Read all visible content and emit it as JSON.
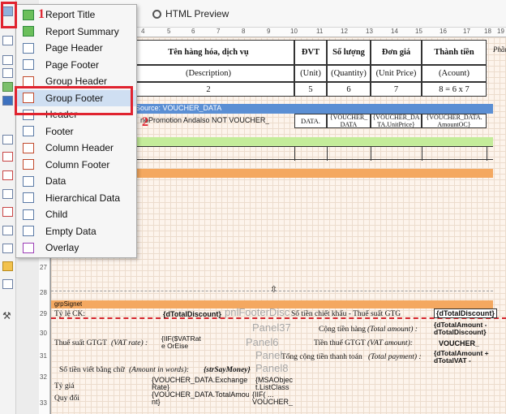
{
  "toolbar": {
    "preview_label": "HTML Preview"
  },
  "ruler_numbers": [
    "4",
    "5",
    "6",
    "7",
    "8",
    "9",
    "10",
    "11",
    "12",
    "13",
    "14",
    "15",
    "16",
    "17",
    "18",
    "19"
  ],
  "vruler_numbers": [
    "27",
    "28",
    "29",
    "30",
    "31",
    "32",
    "33"
  ],
  "menu": {
    "items": [
      {
        "label": "Report Title"
      },
      {
        "label": "Report Summary"
      },
      {
        "label": "Page Header"
      },
      {
        "label": "Page Footer"
      },
      {
        "label": "Group Header"
      },
      {
        "label": "Group Footer"
      },
      {
        "label": "Header"
      },
      {
        "label": "Footer"
      },
      {
        "label": "Column Header"
      },
      {
        "label": "Column Footer"
      },
      {
        "label": "Data"
      },
      {
        "label": "Hierarchical Data"
      },
      {
        "label": "Child"
      },
      {
        "label": "Empty Data"
      },
      {
        "label": "Overlay"
      }
    ]
  },
  "annotations": {
    "step1": "1",
    "step2": "2"
  },
  "table_header": {
    "name": "Tên hàng hóa, dịch vụ",
    "unit": "ĐVT",
    "qty": "Số lượng",
    "price": "Đơn giá",
    "amount": "Thành tiền",
    "right_edge": "Phần",
    "name_en": "(Description)",
    "unit_en": "(Unit)",
    "qty_en": "(Quantity)",
    "price_en": "(Unit Price)",
    "amount_en": "(Acount)",
    "num_name": "2",
    "num_unit": "5",
    "num_qty": "6",
    "num_price": "7",
    "num_amount": "8 = 6 x 7"
  },
  "data_band": {
    "source": "Source: VOUCHER_DATA",
    "row1": "noPromotion Andalso NOT VOUCHER_",
    "c_unit": "DATA.",
    "c_qty": "{VOUCHER_ DATA",
    "c_price": "{VOUCHER_DA TA.UnitPrice}",
    "c_amount": "{VOUCHER_DATA. AmountOC}"
  },
  "footer": {
    "signet": "grpSignet",
    "ck_label": "Tỷ lệ CK:",
    "total_discount": "{dTotalDiscount}",
    "footer_disc": "pnlFooterDisc",
    "so_tien_ck": "Số tiền chiết khấu - Thuế suất GTG",
    "total_discount2": "{dTotalDiscount}",
    "panel37": "Panel37",
    "cong_tien_hang": "Cộng tiền hàng",
    "total_amount_lbl": "(Total amount) :",
    "total_amount": "{dTotalAmount - dTotalDiscount}",
    "thue_suat": "Thuế suất GTGT",
    "vat_rate": "(VAT rate) :",
    "vat_expr": "{IIF($VATRat e OrEise",
    "panel6": "Panel6",
    "tien_thue": "Tiền thuế GTGT",
    "vat_amount_lbl": "(VAT amount):",
    "voucher": "VOUCHER_",
    "panel_x": "Panel",
    "tong_cong": "Tổng cộng tiền thanh toán",
    "total_payment_lbl": "(Total payment) :",
    "total_vat": "{dTotalAmount + dTotalVAT -",
    "panel8": "Panel8",
    "bang_chu": "Số tiền viết bằng chữ",
    "amount_words": "(Amount in words):",
    "say_money": "{strSayMoney}",
    "ty_gia": "Tỷ giá",
    "exchange": "{VOUCHER_DATA.Exchange Rate}",
    "msa_obj": "{MSAObjec t.ListClass",
    "quy_doi": "Quy đổi",
    "total_amou": "{VOUCHER_DATA.TotalAmou nt}",
    "iif_voucher": "{IIF( ... VOUCHER_"
  },
  "colors": {
    "menu_highlight": "#cfdff2",
    "red_marker": "#e0232f",
    "source_band": "#5b8fd4",
    "green_band": "#c4ec9a",
    "orange_band": "#f4a860"
  }
}
